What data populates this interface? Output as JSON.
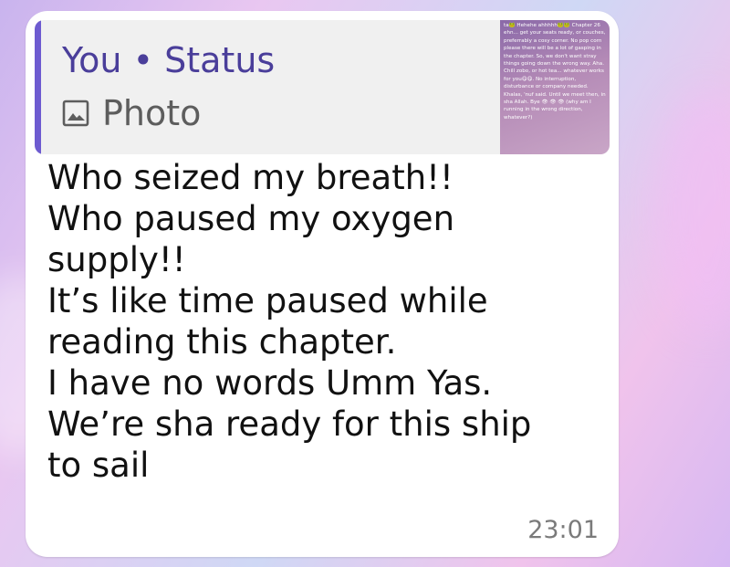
{
  "quoted_status": {
    "sender": "You",
    "separator": "•",
    "label": "Status",
    "media_type": "Photo",
    "media_icon": "photo-icon",
    "thumbnail_text": "ta🐸 Hehehe ahhhhh🐸🐸 Chapter 26 ehn... get your seats ready, or couches, preferrably a cosy corner. No pop corn please there will be a lot of gasping in the chapter. So, we don't want stray things going down the wrong way. Aha. Chill zobo, or hot tea... whatever works for you😋😋. No interruption, disturbance or company needed. Khalas, 'nuf said. Until we meet then, in sha Allah. Bye 👁 👁 👁 (why am I running in the wrong direction, whatever?)",
    "accent_color": "#6d5bd0"
  },
  "message": {
    "lines": [
      "Who seized my breath!!",
      "Who paused my oxygen",
      "supply!!",
      "It’s like time paused while",
      "reading this chapter.",
      "I have no words Umm Yas.",
      "We’re sha ready for this ship",
      "to sail"
    ],
    "time": "23:01"
  }
}
